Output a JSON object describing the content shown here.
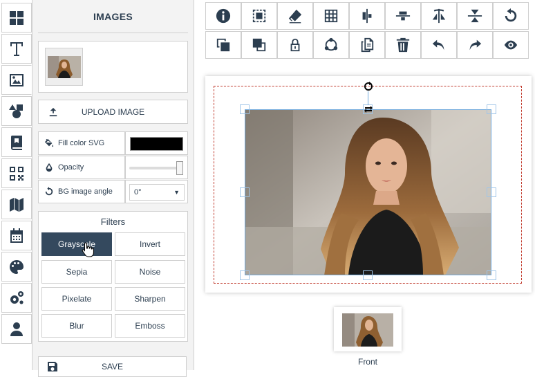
{
  "sidebar": {
    "items": [
      {
        "icon": "grid-icon"
      },
      {
        "icon": "text-icon"
      },
      {
        "icon": "image-icon"
      },
      {
        "icon": "shapes-icon"
      },
      {
        "icon": "book-icon"
      },
      {
        "icon": "qrcode-icon"
      },
      {
        "icon": "map-icon"
      },
      {
        "icon": "calendar-icon"
      },
      {
        "icon": "palette-icon"
      },
      {
        "icon": "gears-icon"
      },
      {
        "icon": "user-icon"
      }
    ]
  },
  "panel": {
    "title": "IMAGES",
    "upload_label": "UPLOAD IMAGE",
    "fill_label": "Fill color SVG",
    "fill_color": "#000000",
    "opacity_label": "Opacity",
    "opacity_value": 1.0,
    "angle_label": "BG image angle",
    "angle_value": "0°",
    "filters_title": "Filters",
    "filters": [
      "Grayscale",
      "Invert",
      "Sepia",
      "Noise",
      "Pixelate",
      "Sharpen",
      "Blur",
      "Emboss"
    ],
    "active_filter": "Grayscale",
    "save_label": "SAVE"
  },
  "toolbar": {
    "row1": [
      "info-icon",
      "select-area-icon",
      "eraser-icon",
      "grid-table-icon",
      "align-vertical-center-icon",
      "align-horizontal-center-icon",
      "flip-horizontal-icon",
      "flip-vertical-icon",
      "undo-rotate-icon"
    ],
    "row2": [
      "send-backward-icon",
      "bring-forward-icon",
      "lock-icon",
      "group-icon",
      "copy-icon",
      "trash-icon",
      "undo-icon",
      "redo-icon",
      "preview-eye-icon"
    ]
  },
  "canvas": {
    "accent_dash": "#c0392b",
    "selection_color": "#6fa8dc"
  },
  "pages": {
    "front_label": "Front"
  }
}
